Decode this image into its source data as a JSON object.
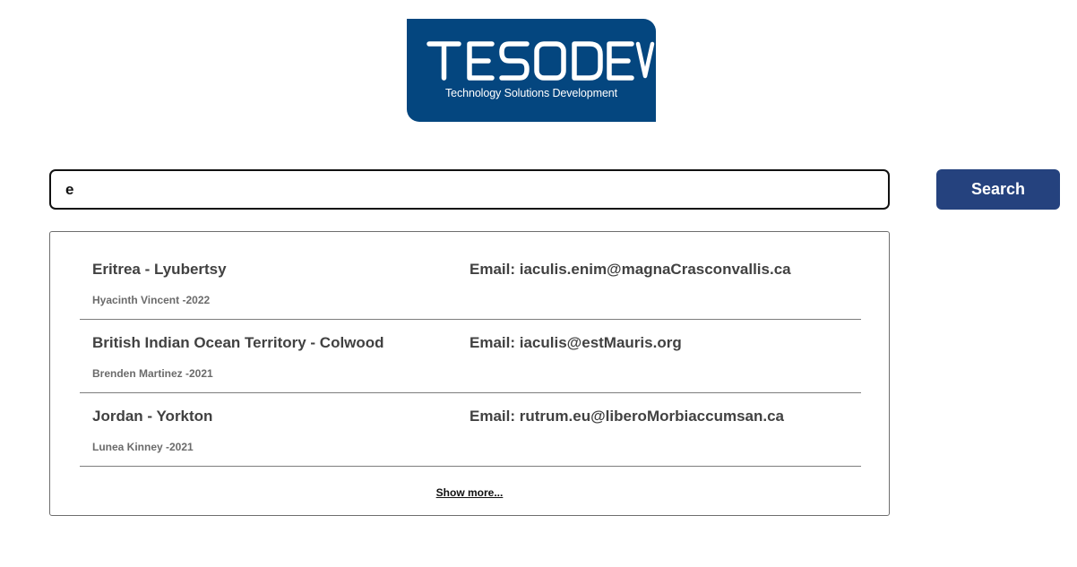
{
  "logo": {
    "name": "TESODEV",
    "tagline": "Technology Solutions Development",
    "background_color": "#04467f"
  },
  "search": {
    "value": "e",
    "placeholder": "",
    "button_label": "Search",
    "button_color": "#25427e"
  },
  "results": [
    {
      "title": "Eritrea - Lyubertsy",
      "subtitle": "Hyacinth Vincent -2022",
      "email": "Email: iaculis.enim@magnaCrasconvallis.ca"
    },
    {
      "title": "British Indian Ocean Territory - Colwood",
      "subtitle": "Brenden Martinez -2021",
      "email": "Email: iaculis@estMauris.org"
    },
    {
      "title": "Jordan - Yorkton",
      "subtitle": "Lunea Kinney -2021",
      "email": "Email: rutrum.eu@liberoMorbiaccumsan.ca"
    }
  ],
  "show_more_label": "Show more..."
}
